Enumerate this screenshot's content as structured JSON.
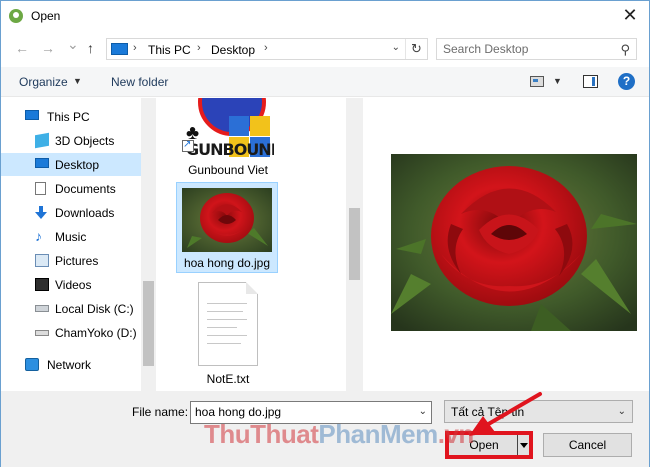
{
  "window": {
    "title": "Open",
    "close_glyph": "✕"
  },
  "nav": {
    "back_glyph": "←",
    "forward_glyph": "→",
    "dropdown_glyph": "⌄",
    "up_glyph": "↑",
    "breadcrumb": [
      "This PC",
      "Desktop"
    ],
    "breadcrumb_sep": "›",
    "address_dropdown_glyph": "⌄",
    "refresh_glyph": "↻",
    "search_placeholder": "Search Desktop",
    "search_glyph": "⚲"
  },
  "toolbar": {
    "organize_label": "Organize",
    "organize_caret": "▼",
    "new_folder_label": "New folder",
    "view_caret": "▼",
    "help_label": "?"
  },
  "sidebar": {
    "items": [
      {
        "label": "This PC",
        "icon": "computer-icon",
        "top": true
      },
      {
        "label": "3D Objects",
        "icon": "3d-objects-icon"
      },
      {
        "label": "Desktop",
        "icon": "desktop-icon",
        "selected": true
      },
      {
        "label": "Documents",
        "icon": "documents-icon"
      },
      {
        "label": "Downloads",
        "icon": "downloads-icon"
      },
      {
        "label": "Music",
        "icon": "music-icon",
        "glyph": "♪"
      },
      {
        "label": "Pictures",
        "icon": "pictures-icon"
      },
      {
        "label": "Videos",
        "icon": "videos-icon"
      },
      {
        "label": "Local Disk (C:)",
        "icon": "local-disk-icon"
      },
      {
        "label": "ChamYoko (D:)",
        "icon": "drive-icon"
      },
      {
        "label": "Network",
        "icon": "network-icon",
        "top": true
      }
    ]
  },
  "files": [
    {
      "label": "Gunbound Viet",
      "thumb_text": "GUNBOUND",
      "club_glyph": "♣",
      "shortcut": true
    },
    {
      "label": "hoa hong do.jpg",
      "selected": true
    },
    {
      "label": "NotE.txt"
    }
  ],
  "preview": {
    "image": "red-rose-photo"
  },
  "bottom": {
    "file_name_label": "File name:",
    "file_name_value": "hoa hong do.jpg",
    "file_name_dropdown_glyph": "⌄",
    "file_type_value": "Tất cả Tệp tin",
    "file_type_dropdown_glyph": "⌄",
    "open_label": "Open",
    "cancel_label": "Cancel"
  },
  "watermark": {
    "part1": "ThuThuat",
    "part2": "PhanMem",
    "part3": ".vn"
  },
  "colors": {
    "selection": "#cce8ff",
    "highlight_red": "#e0141e",
    "accent_blue": "#1a7ad9"
  }
}
